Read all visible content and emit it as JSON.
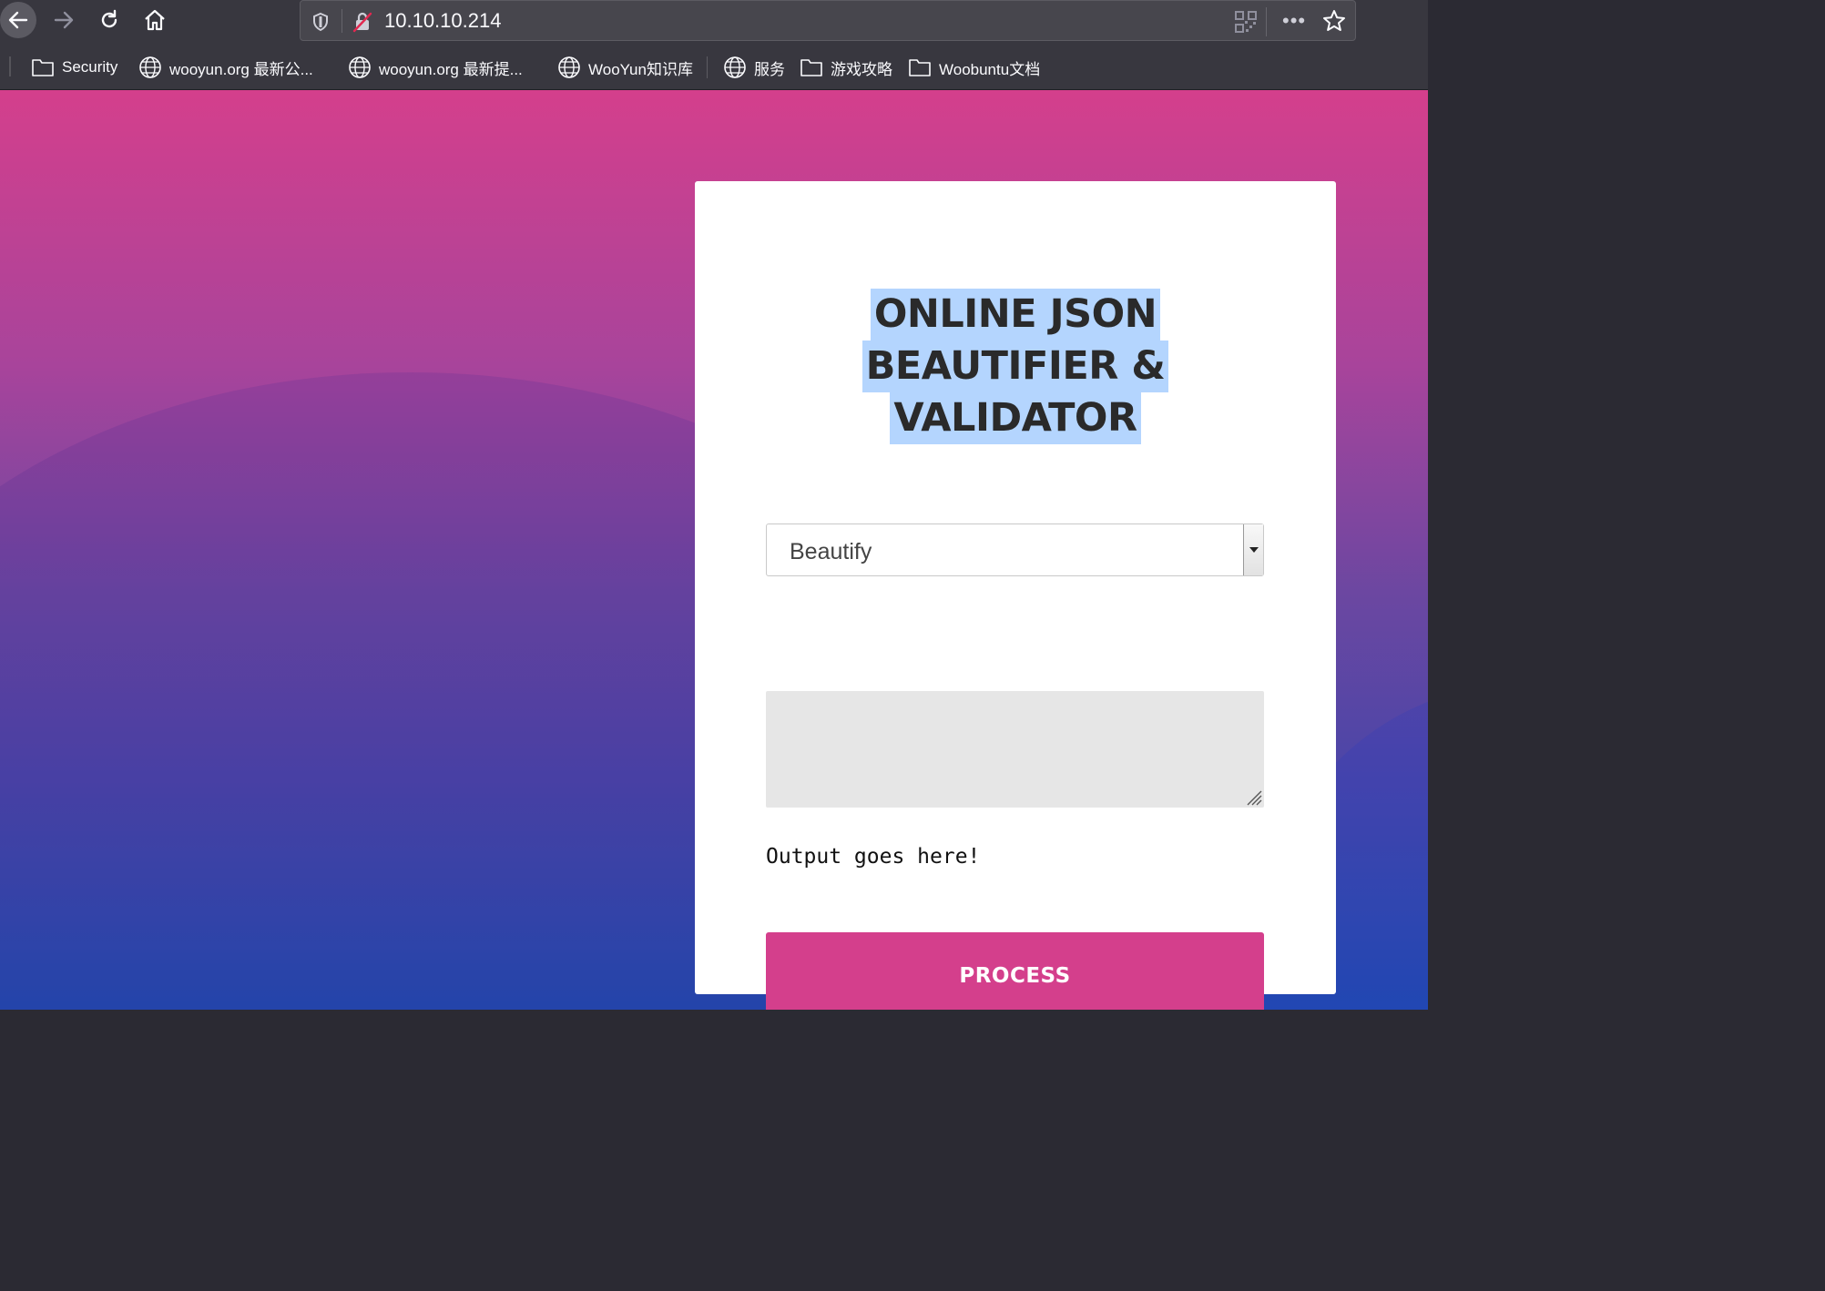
{
  "browser": {
    "url": "10.10.10.214",
    "bookmarks": [
      {
        "label": "Security",
        "icon": "folder-icon"
      },
      {
        "label": "wooyun.org 最新公...",
        "icon": "globe-icon"
      },
      {
        "label": "wooyun.org 最新提...",
        "icon": "globe-icon"
      },
      {
        "label": "WooYun知识库",
        "icon": "globe-icon"
      },
      {
        "label": "服务",
        "icon": "globe-icon"
      },
      {
        "label": "游戏攻略",
        "icon": "folder-icon"
      },
      {
        "label": "Woobuntu文档",
        "icon": "folder-icon"
      }
    ]
  },
  "page": {
    "title_lines": [
      "ONLINE JSON",
      "BEAUTIFIER &",
      "VALIDATOR"
    ],
    "mode_select": {
      "selected": "Beautify"
    },
    "input_value": "",
    "output_text": "Output goes here!",
    "process_label": "PROCESS"
  },
  "colors": {
    "accent": "#d43f8c",
    "gradient_top": "#d43f8c",
    "gradient_bottom": "#1f4bb0",
    "selection_highlight": "#b4d5fe"
  }
}
